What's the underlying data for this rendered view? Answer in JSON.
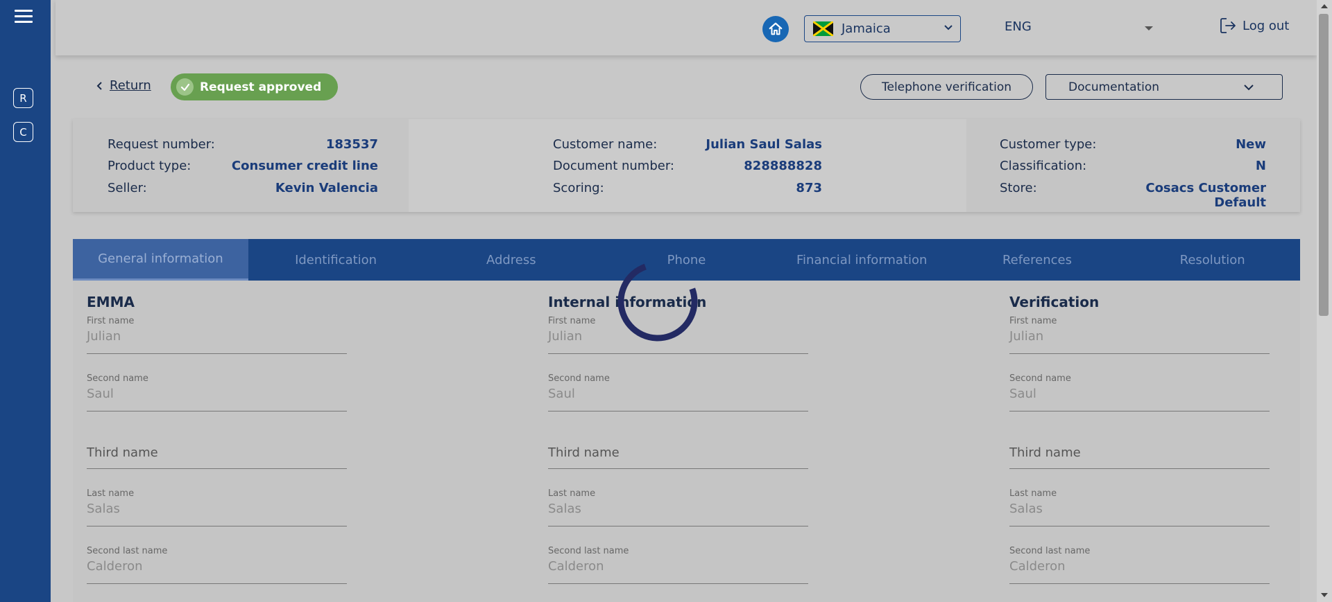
{
  "sidebar": {
    "menu_icon": "hamburger-icon",
    "items": [
      {
        "label": "R"
      },
      {
        "label": "C"
      }
    ]
  },
  "header": {
    "home_icon": "home-icon",
    "country": "Jamaica",
    "language": "ENG",
    "logout_label": "Log out"
  },
  "subheader": {
    "return_label": "Return",
    "status_badge": "Request approved",
    "telephone_verification_label": "Telephone verification",
    "documentation_label": "Documentation"
  },
  "info": {
    "col1": [
      {
        "label": "Request number:",
        "value": "183537"
      },
      {
        "label": "Product type:",
        "value": "Consumer credit line"
      },
      {
        "label": "Seller:",
        "value": "Kevin Valencia"
      }
    ],
    "col2": [
      {
        "label": "Customer name:",
        "value": "Julian Saul Salas"
      },
      {
        "label": "Document number:",
        "value": "828888828"
      },
      {
        "label": "Scoring:",
        "value": "873"
      }
    ],
    "col3": [
      {
        "label": "Customer type:",
        "value": "New"
      },
      {
        "label": "Classification:",
        "value": "N"
      },
      {
        "label": "Store:",
        "value": "Cosacs Customer Default"
      }
    ]
  },
  "tabs": [
    {
      "label": "General information",
      "active": true
    },
    {
      "label": "Identification"
    },
    {
      "label": "Address"
    },
    {
      "label": "Phone"
    },
    {
      "label": "Financial information"
    },
    {
      "label": "References"
    },
    {
      "label": "Resolution"
    }
  ],
  "sections": [
    {
      "title": "EMMA",
      "fields": [
        {
          "label": "First name",
          "value": "Julian"
        },
        {
          "label": "Second name",
          "value": "Saul"
        },
        {
          "placeholder": "Third name"
        },
        {
          "label": "Last name",
          "value": "Salas"
        },
        {
          "label": "Second last name",
          "value": "Calderon"
        }
      ]
    },
    {
      "title": "Internal information",
      "fields": [
        {
          "label": "First name",
          "value": "Julian"
        },
        {
          "label": "Second name",
          "value": "Saul"
        },
        {
          "placeholder": "Third name"
        },
        {
          "label": "Last name",
          "value": "Salas"
        },
        {
          "label": "Second last name",
          "value": "Calderon"
        }
      ]
    },
    {
      "title": "Verification",
      "fields": [
        {
          "label": "First name",
          "value": "Julian"
        },
        {
          "label": "Second name",
          "value": "Saul"
        },
        {
          "placeholder": "Third name"
        },
        {
          "label": "Last name",
          "value": "Salas"
        },
        {
          "label": "Second last name",
          "value": "Calderon"
        }
      ]
    }
  ],
  "colors": {
    "primary": "#1a4584",
    "badge_green": "#68a050",
    "spinner": "#232a63"
  }
}
